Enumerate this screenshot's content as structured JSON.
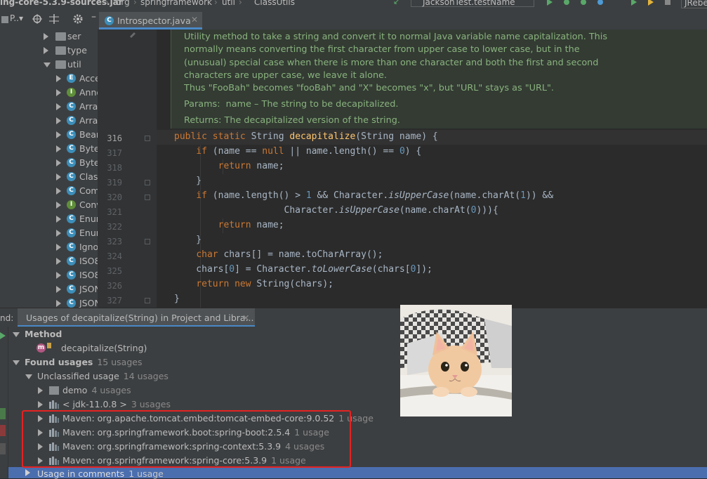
{
  "topbar": {
    "breadcrumbs": [
      "ing-core-5.3.9-sources.jar",
      "org",
      "springframework",
      "util",
      "ClassUtils"
    ],
    "run_config": "JacksonTest.testName",
    "right_label": "JRebe"
  },
  "project_panel": {
    "title": "P..▾",
    "tree": [
      {
        "label": "ser",
        "kind": "folder",
        "expanded": false
      },
      {
        "label": "type",
        "kind": "folder",
        "expanded": false
      },
      {
        "label": "util",
        "kind": "folder",
        "expanded": true
      },
      {
        "label": "Acce",
        "kind": "enum"
      },
      {
        "label": "Anno",
        "kind": "interface"
      },
      {
        "label": "Arra",
        "kind": "class"
      },
      {
        "label": "Arra",
        "kind": "class"
      },
      {
        "label": "Bear",
        "kind": "class"
      },
      {
        "label": "Byte",
        "kind": "class"
      },
      {
        "label": "Byte",
        "kind": "class"
      },
      {
        "label": "Clas",
        "kind": "class"
      },
      {
        "label": "Com",
        "kind": "class"
      },
      {
        "label": "Conv",
        "kind": "interface"
      },
      {
        "label": "Enur",
        "kind": "class"
      },
      {
        "label": "Enur",
        "kind": "class"
      },
      {
        "label": "Igno",
        "kind": "class"
      },
      {
        "label": "ISO8",
        "kind": "class"
      },
      {
        "label": "ISO8",
        "kind": "class"
      },
      {
        "label": "JSON",
        "kind": "class"
      },
      {
        "label": "JSON",
        "kind": "class"
      }
    ]
  },
  "editor": {
    "tab": "Introspector.java",
    "doc": {
      "text": "Utility method to take a string and convert it to normal Java variable name capitalization. This normally means converting the first character from upper case to lower case, but in the (unusual) special case when there is more than one character and both the first and second characters are upper case, we leave it alone.",
      "example": "Thus \"FooBah\" becomes \"fooBah\" and \"X\" becomes \"x\", but \"URL\" stays as \"URL\".",
      "params_label": "Params:",
      "params_text": "name – The string to be decapitalized.",
      "returns_label": "Returns:",
      "returns_text": "The decapitalized version of the string."
    },
    "line_numbers": [
      "316",
      "317",
      "318",
      "319",
      "320",
      "321",
      "322",
      "323",
      "324",
      "325",
      "326",
      "327"
    ]
  },
  "find_panel": {
    "label": "nd:",
    "tab": "Usages of decapitalize(String) in Project and Libra...",
    "method_header": "Method",
    "method_name": "decapitalize(String)",
    "found_label": "Found usages",
    "found_count": "15 usages",
    "unclassified_label": "Unclassified usage",
    "unclassified_count": "14 usages",
    "modules": [
      {
        "label": "demo",
        "count": "4 usages",
        "icon": "folder"
      },
      {
        "label": "< jdk-11.0.8 >",
        "count": "3 usages",
        "icon": "library"
      },
      {
        "label": "Maven: org.apache.tomcat.embed:tomcat-embed-core:9.0.52",
        "count": "1 usage",
        "icon": "library"
      },
      {
        "label": "Maven: org.springframework.boot:spring-boot:2.5.4",
        "count": "1 usage",
        "icon": "library"
      },
      {
        "label": "Maven: org.springframework:spring-context:5.3.9",
        "count": "4 usages",
        "icon": "library"
      },
      {
        "label": "Maven: org.springframework:spring-core:5.3.9",
        "count": "1 usage",
        "icon": "library"
      }
    ],
    "comments_label": "Usage in comments",
    "comments_count": "1 usage"
  },
  "colors": {
    "accent": "#4a88c7",
    "highlight_box": "#e52222",
    "selection": "#4b6eaf",
    "doc_text": "#8ab37e",
    "keyword": "#cc7832"
  }
}
